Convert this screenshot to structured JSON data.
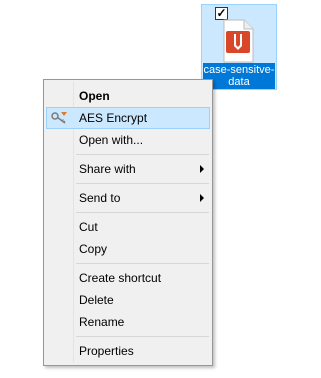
{
  "desktop": {
    "file": {
      "name": "case-sensitve-data",
      "icon": "pdf-file-icon",
      "checked": true,
      "check_mark": "✓"
    }
  },
  "context_menu": {
    "items": [
      {
        "label": "Open",
        "bold": true
      },
      {
        "label": "AES Encrypt",
        "icon": "encrypt-key-icon",
        "highlighted": true
      },
      {
        "label": "Open with..."
      },
      {
        "label": "Share with",
        "submenu": true
      },
      {
        "label": "Send to",
        "submenu": true
      },
      {
        "label": "Cut"
      },
      {
        "label": "Copy"
      },
      {
        "label": "Create shortcut"
      },
      {
        "label": "Delete"
      },
      {
        "label": "Rename"
      },
      {
        "label": "Properties"
      }
    ]
  },
  "colors": {
    "selection": "#cce8ff",
    "selection_border": "#99d1ff",
    "file_label_bg": "#0078d7",
    "pdf_red": "#d9472b"
  }
}
